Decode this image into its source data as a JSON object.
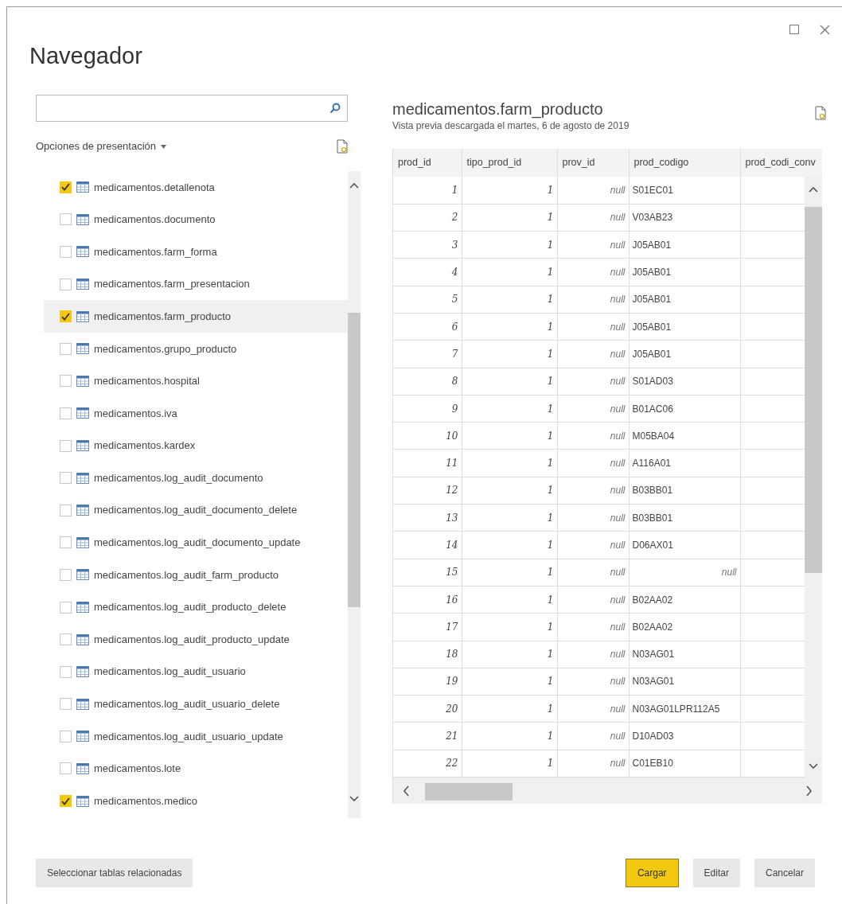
{
  "window": {
    "title": "Navegador"
  },
  "display_options": {
    "label": "Opciones de presentación"
  },
  "tables": [
    {
      "name": "medicamentos.detallenota",
      "checked": true,
      "selected": false
    },
    {
      "name": "medicamentos.documento",
      "checked": false,
      "selected": false
    },
    {
      "name": "medicamentos.farm_forma",
      "checked": false,
      "selected": false
    },
    {
      "name": "medicamentos.farm_presentacion",
      "checked": false,
      "selected": false
    },
    {
      "name": "medicamentos.farm_producto",
      "checked": true,
      "selected": true
    },
    {
      "name": "medicamentos.grupo_producto",
      "checked": false,
      "selected": false
    },
    {
      "name": "medicamentos.hospital",
      "checked": false,
      "selected": false
    },
    {
      "name": "medicamentos.iva",
      "checked": false,
      "selected": false
    },
    {
      "name": "medicamentos.kardex",
      "checked": false,
      "selected": false
    },
    {
      "name": "medicamentos.log_audit_documento",
      "checked": false,
      "selected": false
    },
    {
      "name": "medicamentos.log_audit_documento_delete",
      "checked": false,
      "selected": false
    },
    {
      "name": "medicamentos.log_audit_documento_update",
      "checked": false,
      "selected": false
    },
    {
      "name": "medicamentos.log_audit_farm_producto",
      "checked": false,
      "selected": false
    },
    {
      "name": "medicamentos.log_audit_producto_delete",
      "checked": false,
      "selected": false
    },
    {
      "name": "medicamentos.log_audit_producto_update",
      "checked": false,
      "selected": false
    },
    {
      "name": "medicamentos.log_audit_usuario",
      "checked": false,
      "selected": false
    },
    {
      "name": "medicamentos.log_audit_usuario_delete",
      "checked": false,
      "selected": false
    },
    {
      "name": "medicamentos.log_audit_usuario_update",
      "checked": false,
      "selected": false
    },
    {
      "name": "medicamentos.lote",
      "checked": false,
      "selected": false
    },
    {
      "name": "medicamentos.medico",
      "checked": true,
      "selected": false
    }
  ],
  "preview": {
    "title": "medicamentos.farm_producto",
    "subtitle": "Vista previa descargada el martes, 6 de agosto de 2019",
    "columns": [
      "prod_id",
      "tipo_prod_id",
      "prov_id",
      "prod_codigo",
      "prod_codi_conv"
    ],
    "rows": [
      [
        {
          "text": "1",
          "kind": "number"
        },
        {
          "text": "1",
          "kind": "number"
        },
        {
          "text": "null",
          "kind": "null"
        },
        {
          "text": "S01EC01",
          "kind": "text"
        }
      ],
      [
        {
          "text": "2",
          "kind": "number"
        },
        {
          "text": "1",
          "kind": "number"
        },
        {
          "text": "null",
          "kind": "null"
        },
        {
          "text": "V03AB23",
          "kind": "text"
        }
      ],
      [
        {
          "text": "3",
          "kind": "number"
        },
        {
          "text": "1",
          "kind": "number"
        },
        {
          "text": "null",
          "kind": "null"
        },
        {
          "text": "J05AB01",
          "kind": "text"
        }
      ],
      [
        {
          "text": "4",
          "kind": "number"
        },
        {
          "text": "1",
          "kind": "number"
        },
        {
          "text": "null",
          "kind": "null"
        },
        {
          "text": "J05AB01",
          "kind": "text"
        }
      ],
      [
        {
          "text": "5",
          "kind": "number"
        },
        {
          "text": "1",
          "kind": "number"
        },
        {
          "text": "null",
          "kind": "null"
        },
        {
          "text": "J05AB01",
          "kind": "text"
        }
      ],
      [
        {
          "text": "6",
          "kind": "number"
        },
        {
          "text": "1",
          "kind": "number"
        },
        {
          "text": "null",
          "kind": "null"
        },
        {
          "text": "J05AB01",
          "kind": "text"
        }
      ],
      [
        {
          "text": "7",
          "kind": "number"
        },
        {
          "text": "1",
          "kind": "number"
        },
        {
          "text": "null",
          "kind": "null"
        },
        {
          "text": "J05AB01",
          "kind": "text"
        }
      ],
      [
        {
          "text": "8",
          "kind": "number"
        },
        {
          "text": "1",
          "kind": "number"
        },
        {
          "text": "null",
          "kind": "null"
        },
        {
          "text": "S01AD03",
          "kind": "text"
        }
      ],
      [
        {
          "text": "9",
          "kind": "number"
        },
        {
          "text": "1",
          "kind": "number"
        },
        {
          "text": "null",
          "kind": "null"
        },
        {
          "text": "B01AC06",
          "kind": "text"
        }
      ],
      [
        {
          "text": "10",
          "kind": "number"
        },
        {
          "text": "1",
          "kind": "number"
        },
        {
          "text": "null",
          "kind": "null"
        },
        {
          "text": "M05BA04",
          "kind": "text"
        }
      ],
      [
        {
          "text": "11",
          "kind": "number"
        },
        {
          "text": "1",
          "kind": "number"
        },
        {
          "text": "null",
          "kind": "null"
        },
        {
          "text": "A116A01",
          "kind": "text"
        }
      ],
      [
        {
          "text": "12",
          "kind": "number"
        },
        {
          "text": "1",
          "kind": "number"
        },
        {
          "text": "null",
          "kind": "null"
        },
        {
          "text": "B03BB01",
          "kind": "text"
        }
      ],
      [
        {
          "text": "13",
          "kind": "number"
        },
        {
          "text": "1",
          "kind": "number"
        },
        {
          "text": "null",
          "kind": "null"
        },
        {
          "text": "B03BB01",
          "kind": "text"
        }
      ],
      [
        {
          "text": "14",
          "kind": "number"
        },
        {
          "text": "1",
          "kind": "number"
        },
        {
          "text": "null",
          "kind": "null"
        },
        {
          "text": "D06AX01",
          "kind": "text"
        }
      ],
      [
        {
          "text": "15",
          "kind": "number"
        },
        {
          "text": "1",
          "kind": "number"
        },
        {
          "text": "null",
          "kind": "null"
        },
        {
          "text": "null",
          "kind": "null"
        }
      ],
      [
        {
          "text": "16",
          "kind": "number"
        },
        {
          "text": "1",
          "kind": "number"
        },
        {
          "text": "null",
          "kind": "null"
        },
        {
          "text": "B02AA02",
          "kind": "text"
        }
      ],
      [
        {
          "text": "17",
          "kind": "number"
        },
        {
          "text": "1",
          "kind": "number"
        },
        {
          "text": "null",
          "kind": "null"
        },
        {
          "text": "B02AA02",
          "kind": "text"
        }
      ],
      [
        {
          "text": "18",
          "kind": "number"
        },
        {
          "text": "1",
          "kind": "number"
        },
        {
          "text": "null",
          "kind": "null"
        },
        {
          "text": "N03AG01",
          "kind": "text"
        }
      ],
      [
        {
          "text": "19",
          "kind": "number"
        },
        {
          "text": "1",
          "kind": "number"
        },
        {
          "text": "null",
          "kind": "null"
        },
        {
          "text": "N03AG01",
          "kind": "text"
        }
      ],
      [
        {
          "text": "20",
          "kind": "number"
        },
        {
          "text": "1",
          "kind": "number"
        },
        {
          "text": "null",
          "kind": "null"
        },
        {
          "text": "N03AG01LPR112A5",
          "kind": "text"
        }
      ],
      [
        {
          "text": "21",
          "kind": "number"
        },
        {
          "text": "1",
          "kind": "number"
        },
        {
          "text": "null",
          "kind": "null"
        },
        {
          "text": "D10AD03",
          "kind": "text"
        }
      ],
      [
        {
          "text": "22",
          "kind": "number"
        },
        {
          "text": "1",
          "kind": "number"
        },
        {
          "text": "null",
          "kind": "null"
        },
        {
          "text": "C01EB10",
          "kind": "text"
        }
      ]
    ]
  },
  "buttons": [
    {
      "label": "Seleccionar tablas relacionadas",
      "kind": "secondary"
    },
    {
      "label": "Cargar",
      "kind": "primary"
    },
    {
      "label": "Editar",
      "kind": "secondary"
    },
    {
      "label": "Cancelar",
      "kind": "secondary"
    }
  ]
}
